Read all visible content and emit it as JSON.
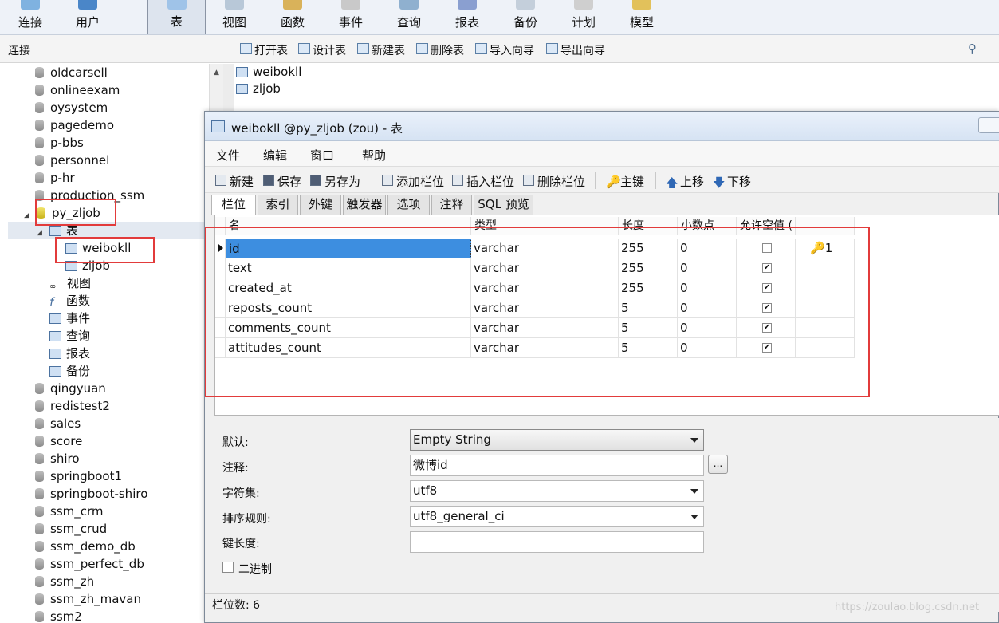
{
  "toolbar": {
    "items": [
      {
        "label": "连接",
        "icon": "connection-icon"
      },
      {
        "label": "用户",
        "icon": "user-icon"
      },
      {
        "label": "表",
        "icon": "table-icon",
        "active": true
      },
      {
        "label": "视图",
        "icon": "view-icon"
      },
      {
        "label": "函数",
        "icon": "function-icon"
      },
      {
        "label": "事件",
        "icon": "event-icon"
      },
      {
        "label": "查询",
        "icon": "query-icon"
      },
      {
        "label": "报表",
        "icon": "report-icon"
      },
      {
        "label": "备份",
        "icon": "backup-icon"
      },
      {
        "label": "计划",
        "icon": "schedule-icon"
      },
      {
        "label": "模型",
        "icon": "model-icon"
      }
    ]
  },
  "left_header": "连接",
  "object_toolbar": [
    "打开表",
    "设计表",
    "新建表",
    "删除表",
    "导入向导",
    "导出向导"
  ],
  "tree": {
    "databases_top": [
      "oldcarsell",
      "onlineexam",
      "oysystem",
      "pagedemo",
      "p-bbs",
      "personnel",
      "p-hr",
      "production_ssm"
    ],
    "open_db": "py_zljob",
    "tables_node": "表",
    "tables": [
      "weibokll",
      "zljob"
    ],
    "other_nodes": [
      "视图",
      "函数",
      "事件",
      "查询",
      "报表",
      "备份"
    ],
    "databases_bottom": [
      "qingyuan",
      "redistest2",
      "sales",
      "score",
      "shiro",
      "springboot1",
      "springboot-shiro",
      "ssm_crm",
      "ssm_crud",
      "ssm_demo_db",
      "ssm_perfect_db",
      "ssm_zh",
      "ssm_zh_mavan",
      "ssm2"
    ]
  },
  "object_list": [
    "weibokll",
    "zljob"
  ],
  "dialog": {
    "title": "weibokll @py_zljob (zou) - 表",
    "menu": [
      "文件",
      "编辑",
      "窗口",
      "帮助"
    ],
    "toolbar": [
      "新建",
      "保存",
      "另存为",
      "添加栏位",
      "插入栏位",
      "删除栏位",
      "主键",
      "上移",
      "下移"
    ],
    "tabs": [
      "栏位",
      "索引",
      "外键",
      "触发器",
      "选项",
      "注释",
      "SQL 预览"
    ],
    "columns": [
      "名",
      "类型",
      "长度",
      "小数点",
      "允许空值 (",
      ""
    ],
    "rows": [
      {
        "name": "id",
        "type": "varchar",
        "length": "255",
        "decimals": "0",
        "nullable": false,
        "key": "1"
      },
      {
        "name": "text",
        "type": "varchar",
        "length": "255",
        "decimals": "0",
        "nullable": true,
        "key": ""
      },
      {
        "name": "created_at",
        "type": "varchar",
        "length": "255",
        "decimals": "0",
        "nullable": true,
        "key": ""
      },
      {
        "name": "reposts_count",
        "type": "varchar",
        "length": "5",
        "decimals": "0",
        "nullable": true,
        "key": ""
      },
      {
        "name": "comments_count",
        "type": "varchar",
        "length": "5",
        "decimals": "0",
        "nullable": true,
        "key": ""
      },
      {
        "name": "attitudes_count",
        "type": "varchar",
        "length": "5",
        "decimals": "0",
        "nullable": true,
        "key": ""
      }
    ],
    "props": {
      "default_label": "默认:",
      "default_value": "Empty String",
      "comment_label": "注释:",
      "comment_value": "微博id",
      "charset_label": "字符集:",
      "charset_value": "utf8",
      "collation_label": "排序规则:",
      "collation_value": "utf8_general_ci",
      "keylen_label": "键长度:",
      "keylen_value": "",
      "binary_label": "二进制",
      "ellipsis": "..."
    },
    "status": "栏位数: 6"
  },
  "watermark": "https://zoulao.blog.csdn.net",
  "colors": {
    "highlight": "#e23b3b",
    "selection": "#3d8ee0"
  }
}
